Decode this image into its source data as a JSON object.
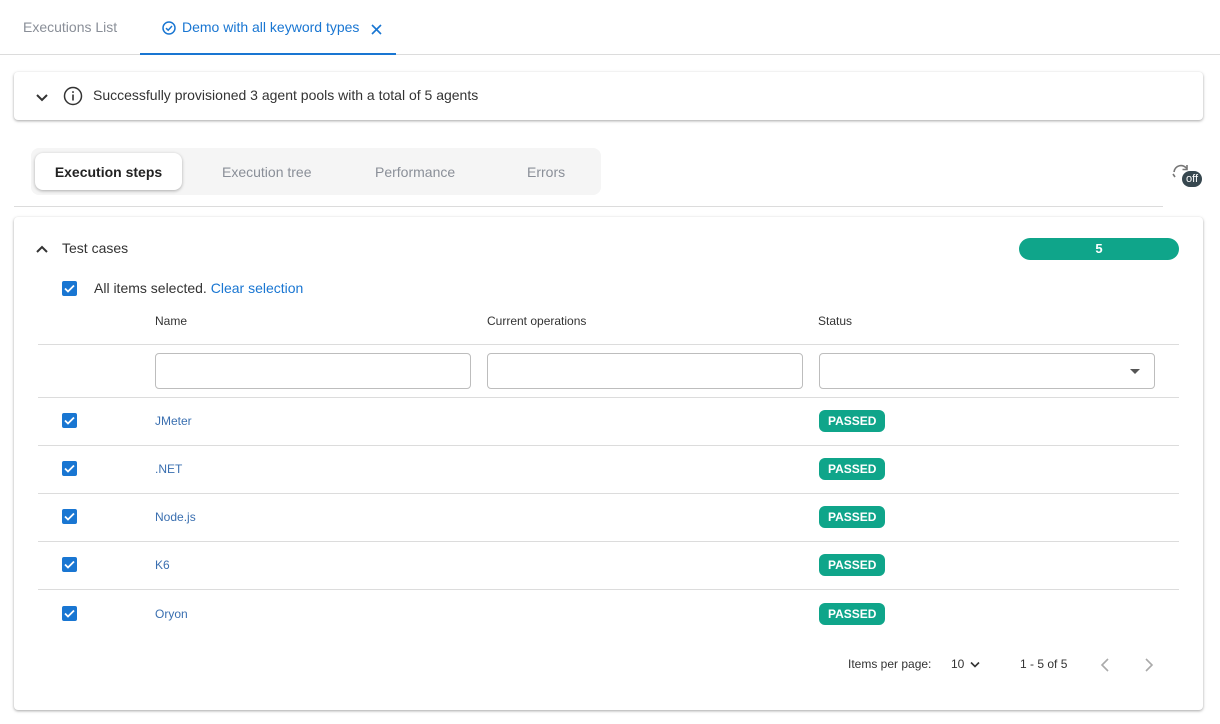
{
  "tabs": {
    "list_label": "Executions List",
    "active_label": "Demo with all keyword types"
  },
  "banner": {
    "message": "Successfully provisioned 3 agent pools with a total of 5 agents"
  },
  "subtabs": [
    "Execution steps",
    "Execution tree",
    "Performance",
    "Errors"
  ],
  "refresh": {
    "badge": "off"
  },
  "panel": {
    "title": "Test cases",
    "count": "5",
    "selection_text": "All items selected.",
    "clear_label": "Clear selection"
  },
  "table": {
    "headers": [
      "Name",
      "Current operations",
      "Status"
    ],
    "rows": [
      {
        "name": "JMeter",
        "status": "PASSED"
      },
      {
        "name": ".NET",
        "status": "PASSED"
      },
      {
        "name": "Node.js",
        "status": "PASSED"
      },
      {
        "name": "K6",
        "status": "PASSED"
      },
      {
        "name": "Oryon",
        "status": "PASSED"
      }
    ]
  },
  "pagination": {
    "items_per_page_label": "Items per page:",
    "page_size": "10",
    "range": "1 - 5 of 5"
  },
  "colors": {
    "accent": "#1976d2",
    "status_passed": "#0fa58a"
  }
}
